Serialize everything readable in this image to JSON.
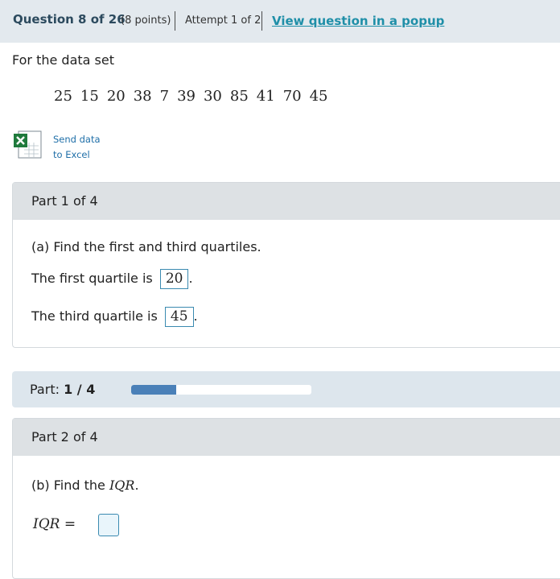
{
  "header": {
    "question_title": "Question 8 of 26",
    "points": "(8 points)",
    "attempt": "Attempt 1 of 2",
    "popup_link": "View question in a popup"
  },
  "intro": "For the data set",
  "dataset": [
    "25",
    "15",
    "20",
    "38",
    "7",
    "39",
    "30",
    "85",
    "41",
    "70",
    "45"
  ],
  "excel": {
    "icon": "excel-icon",
    "line1": "Send data",
    "line2": "to Excel"
  },
  "part1": {
    "title": "Part 1 of 4",
    "prompt": "(a) Find the first and third quartiles.",
    "first_label": "The first quartile is",
    "first_value": "20",
    "third_label": "The third quartile is",
    "third_value": "45",
    "period": "."
  },
  "progress": {
    "label": "Part:",
    "value_text": "1 / 4",
    "fraction": 0.25,
    "fill_color": "#4a80b8"
  },
  "part2": {
    "title": "Part 2 of 4",
    "prompt_prefix": "(b) Find the",
    "prompt_math": "IQR",
    "prompt_suffix": ".",
    "iqr_label": "IQR",
    "equals": "="
  }
}
